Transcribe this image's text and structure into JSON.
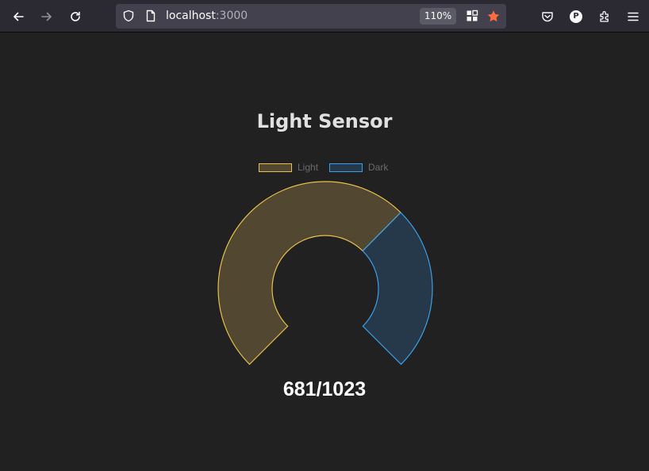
{
  "browser": {
    "url_host": "localhost",
    "url_port": ":3000",
    "zoom_level": "110%",
    "avatar_letter": "P"
  },
  "sensor": {
    "title": "Light Sensor",
    "reading_text": "681/1023",
    "value": 681,
    "max": 1023,
    "legend": [
      {
        "label": "Light",
        "fill": "#524730",
        "stroke": "#e8c14a"
      },
      {
        "label": "Dark",
        "fill": "#26394a",
        "stroke": "#3aa0e6"
      }
    ],
    "accent": "#ff6b3d"
  }
}
